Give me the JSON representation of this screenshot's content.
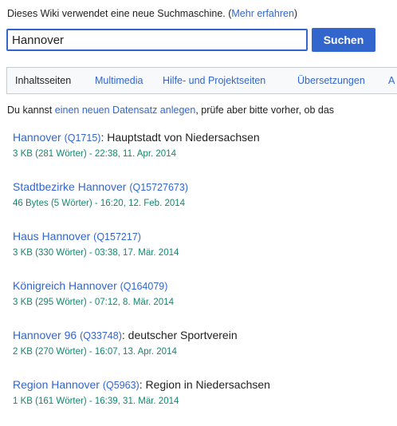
{
  "notice": {
    "text": "Dieses Wiki verwendet eine neue Suchmaschine. (",
    "link": "Mehr erfahren",
    "suffix": ")"
  },
  "search": {
    "value": "Hannover",
    "button": "Suchen"
  },
  "tabs": [
    {
      "label": "Inhaltsseiten"
    },
    {
      "label": "Multimedia"
    },
    {
      "label": "Hilfe- und Projektseiten"
    },
    {
      "label": "Übersetzungen"
    },
    {
      "label": "A"
    }
  ],
  "info": {
    "prefix": "Du kannst ",
    "link": "einen neuen Datensatz anlegen",
    "suffix": ", prüfe aber bitte vorher, ob das"
  },
  "results": [
    {
      "title": "Hannover",
      "id": "(Q1715)",
      "desc": ": Hauptstadt von Niedersachsen",
      "meta": "3 KB (281 Wörter) - 22:38, 11. Apr. 2014"
    },
    {
      "title": "Stadtbezirke Hannover",
      "id": "(Q15727673)",
      "desc": "",
      "meta": "46 Bytes (5 Wörter) - 16:20, 12. Feb. 2014"
    },
    {
      "title": "Haus Hannover",
      "id": "(Q157217)",
      "desc": "",
      "meta": "3 KB (330 Wörter) - 03:38, 17. Mär. 2014"
    },
    {
      "title": "Königreich Hannover",
      "id": "(Q164079)",
      "desc": "",
      "meta": "3 KB (295 Wörter) - 07:12, 8. Mär. 2014"
    },
    {
      "title": "Hannover 96",
      "id": "(Q33748)",
      "desc": ": deutscher Sportverein",
      "meta": "2 KB (270 Wörter) - 16:07, 13. Apr. 2014"
    },
    {
      "title": "Region Hannover",
      "id": "(Q5963)",
      "desc": ": Region in Niedersachsen",
      "meta": "1 KB (161 Wörter) - 16:39, 31. Mär. 2014"
    }
  ]
}
